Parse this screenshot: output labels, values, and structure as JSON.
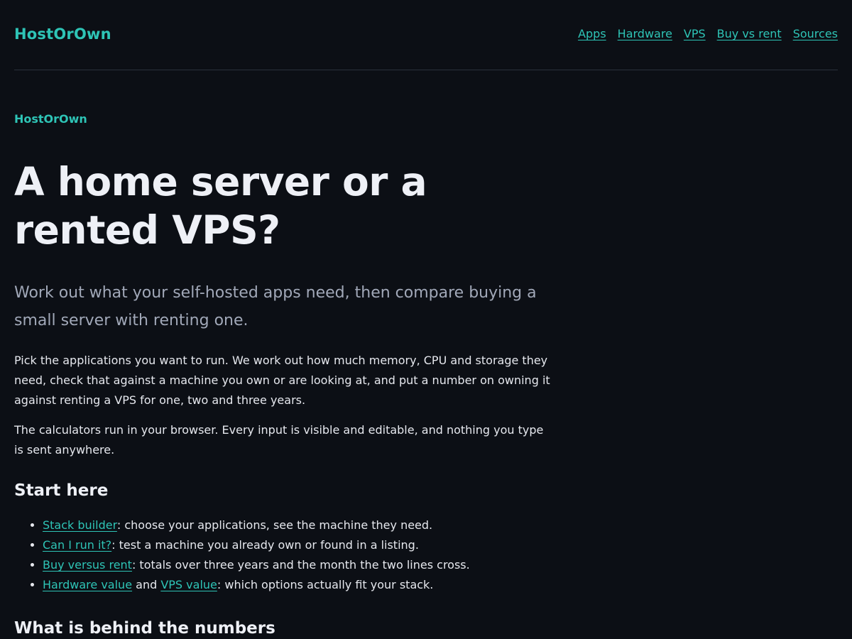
{
  "header": {
    "brand": "HostOrOwn",
    "nav": [
      "Apps",
      "Hardware",
      "VPS",
      "Buy vs rent",
      "Sources"
    ]
  },
  "main": {
    "eyebrow": "HostOrOwn",
    "title": "A home server or a rented VPS?",
    "lead": "Work out what your self-hosted apps need, then compare buying a small server with renting one.",
    "paragraphs": [
      "Pick the applications you want to run. We work out how much memory, CPU and storage they need, check that against a machine you own or are looking at, and put a number on owning it against renting a VPS for one, two and three years.",
      "The calculators run in your browser. Every input is visible and editable, and nothing you type is sent anywhere."
    ],
    "start_heading": "Start here",
    "start_items": [
      {
        "link": "Stack builder",
        "text": ": choose your applications, see the machine they need."
      },
      {
        "link": "Can I run it?",
        "text": ": test a machine you already own or found in a listing."
      },
      {
        "link": "Buy versus rent",
        "text": ": totals over three years and the month the two lines cross."
      },
      {
        "link": "Hardware value",
        "mid": " and ",
        "link2": "VPS value",
        "text": ": which options actually fit your stack."
      }
    ],
    "behind_heading": "What is behind the numbers"
  },
  "colors": {
    "background": "#0c0f15",
    "accent": "#2ec4b6",
    "text": "#e6e8ee",
    "muted": "#a1a8b8",
    "divider": "#2b313c"
  }
}
